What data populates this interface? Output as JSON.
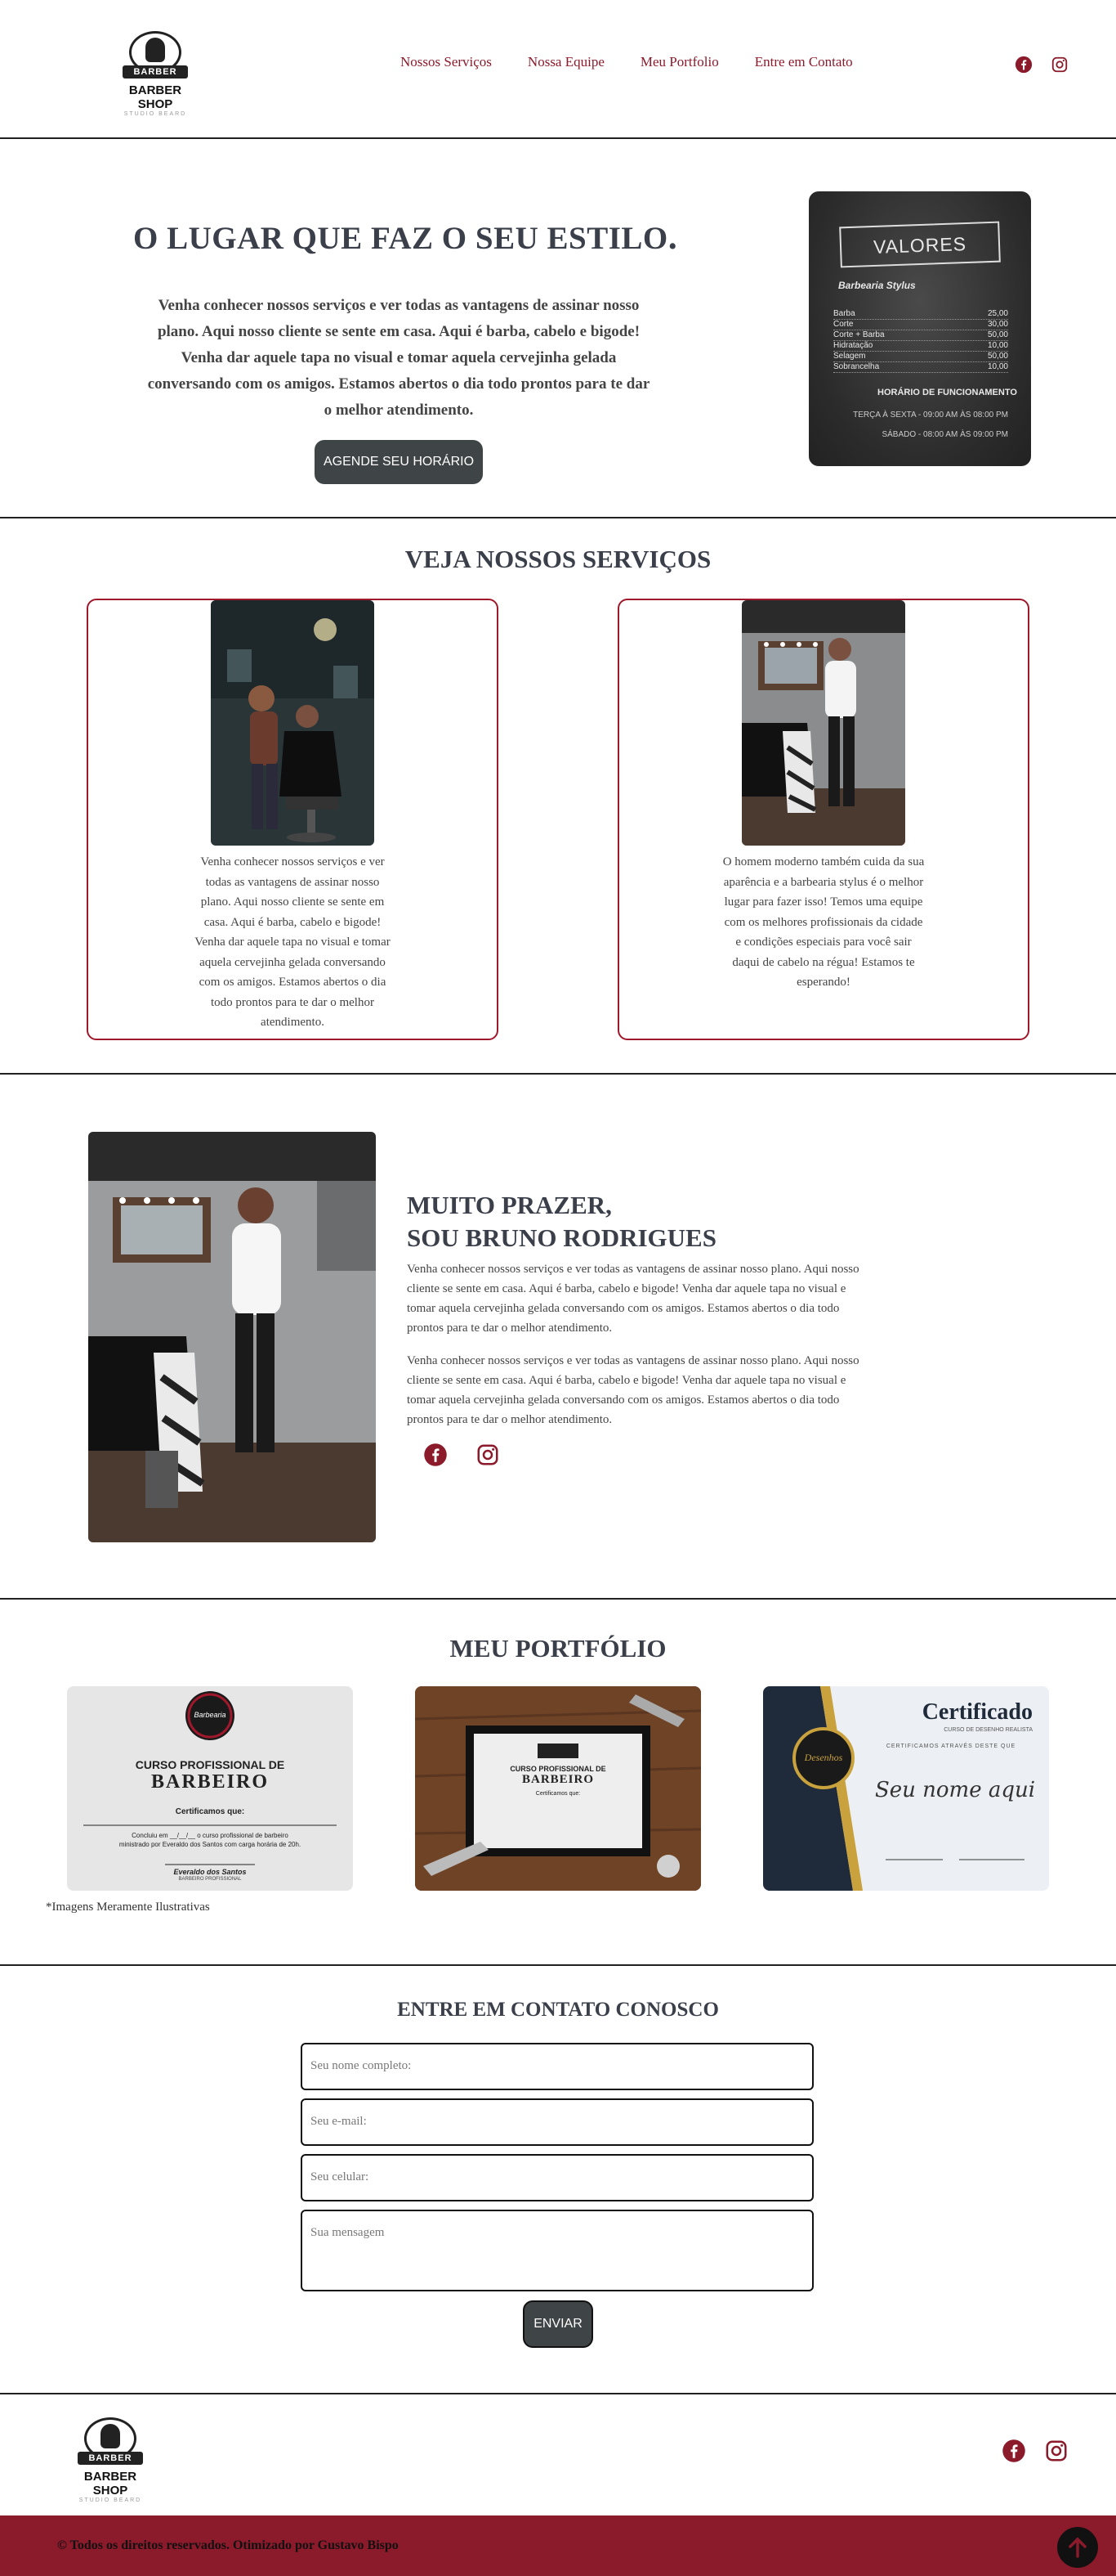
{
  "header": {
    "logo_text": "BARBER SHOP",
    "logo_badge": "BARBER",
    "logo_subtext": "STUDIO BEARD",
    "nav": [
      "Nossos Serviços",
      "Nossa Equipe",
      "Meu Portfolio",
      "Entre em Contato"
    ],
    "social": [
      "facebook-icon",
      "instagram-icon"
    ]
  },
  "hero": {
    "title": "O LUGAR QUE FAZ O SEU ESTILO",
    "text": "Venha conhecer nossos serviços e ver todas as vantagens de assinar nosso plano. Aqui nosso cliente se sente em casa. Aqui é barba, cabelo e bigode! Venha dar aquele tapa no visual e tomar aquela cervejinha gelada conversando com os amigos. Estamos abertos o dia todo prontos para te dar o melhor atendimento.",
    "button": "AGENDE SEU HORÁRIO",
    "chalkboard": {
      "title": "VALORES",
      "subtitle": "Barbearia Stylus",
      "prices": [
        {
          "item": "Barba",
          "price": "25,00"
        },
        {
          "item": "Corte",
          "price": "30,00"
        },
        {
          "item": "Corte + Barba",
          "price": "50,00"
        },
        {
          "item": "Hidratação",
          "price": "10,00"
        },
        {
          "item": "Selagem",
          "price": "50,00"
        },
        {
          "item": "Sobrancelha",
          "price": "10,00"
        }
      ],
      "hours_title": "HORÁRIO DE FUNCIONAMENTO",
      "hours": [
        "TERÇA À SEXTA - 09:00 AM ÀS 08:00 PM",
        "SÁBADO - 08:00 AM ÀS 09:00 PM"
      ]
    }
  },
  "services": {
    "title": "VEJA NOSSOS SERVIÇOS",
    "cards": [
      {
        "text": "Venha conhecer nossos serviços e ver todas as vantagens de assinar nosso plano. Aqui nosso cliente se sente em casa. Aqui é barba, cabelo e bigode! Venha dar aquele tapa no visual e tomar aquela cervejinha gelada conversando com os amigos. Estamos abertos o dia todo prontos para te dar o melhor atendimento."
      },
      {
        "text": "O homem moderno também cuida da sua aparência e a barbearia stylus é o melhor lugar para fazer isso! Temos uma equipe com os melhores profissionais da cidade e condições especiais para você sair daqui de cabelo na régua! Estamos te esperando!"
      }
    ]
  },
  "about": {
    "title_line1": "MUITO PRAZER,",
    "title_line2": "SOU BRUNO RODRIGUES",
    "paragraph1": "Venha conhecer nossos serviços e ver todas as vantagens de assinar nosso plano. Aqui nosso cliente se sente em casa. Aqui é barba, cabelo e bigode! Venha dar aquele tapa no visual e tomar aquela cervejinha gelada conversando com os amigos. Estamos abertos o dia todo prontos para te dar o melhor atendimento.",
    "paragraph2": "Venha conhecer nossos serviços e ver todas as vantagens de assinar nosso plano. Aqui nosso cliente se sente em casa. Aqui é barba, cabelo e bigode! Venha dar aquele tapa no visual e tomar aquela cervejinha gelada conversando com os amigos. Estamos abertos o dia todo prontos para te dar o melhor atendimento."
  },
  "portfolio": {
    "title": "MEU PORTFÓLIO",
    "note": "*Imagens Meramente Ilustrativas",
    "cert1": {
      "badge": "Barbearia",
      "course": "CURSO PROFISSIONAL DE",
      "name": "BARBEIRO",
      "certify": "Certificamos que:",
      "line1": "Concluiu em __/__/__ o curso profissional de barbeiro",
      "line2": "ministrado por Everaldo dos Santos com carga horária de 20h.",
      "sign": "Everaldo dos Santos",
      "role": "BARBEIRO PROFISSIONAL"
    },
    "cert2": {
      "course": "CURSO PROFISSIONAL DE",
      "name": "BARBEIRO",
      "certify": "Certificamos que:"
    },
    "cert3": {
      "title": "Certificado",
      "subtitle": "CURSO DE DESENHO REALISTA",
      "line": "CERTIFICAMOS ATRAVÉS DESTE QUE",
      "name": "Seu nome aqui",
      "badge": "Desenhos"
    }
  },
  "contact": {
    "title": "ENTRE EM CONTATO CONOSCO",
    "name_placeholder": "Seu nome completo:",
    "email_placeholder": "Seu e-mail:",
    "phone_placeholder": "Seu celular:",
    "message_placeholder": "Sua mensagem",
    "send": "ENVIAR"
  },
  "footer": {
    "copyright": "© Todos os direitos reservados. Otimizado por Gustavo Bispo"
  },
  "colors": {
    "accent": "#8b1a2b",
    "dark_button": "#3f4446"
  }
}
